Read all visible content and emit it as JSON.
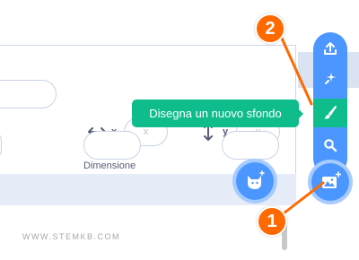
{
  "sprite_info": {
    "x_label": "x",
    "x_placeholder": "x",
    "y_label": "y",
    "y_placeholder": "y",
    "size_label": "Dimensione"
  },
  "backdrop_menu": {
    "items": [
      {
        "icon": "upload-icon"
      },
      {
        "icon": "surprise-icon"
      },
      {
        "icon": "paint-brush-icon"
      },
      {
        "icon": "search-icon"
      }
    ],
    "main_icon": "add-backdrop-icon",
    "tooltip": "Disegna un nuovo sfondo"
  },
  "sprite_button_icon": "add-sprite-icon",
  "callouts": {
    "first": "1",
    "second": "2"
  },
  "colors": {
    "blue": "#4c97ff",
    "green": "#0fbd8c",
    "orange": "#ff6a00"
  },
  "watermark": "WWW.STEMKB.COM"
}
